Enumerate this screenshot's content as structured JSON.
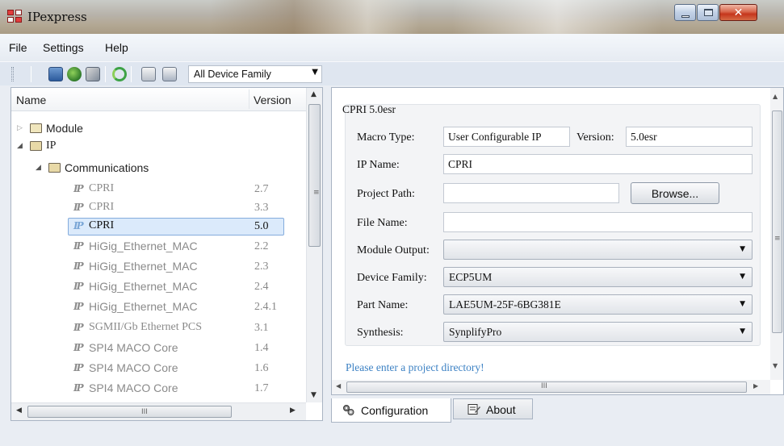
{
  "window": {
    "title": "IPexpress"
  },
  "menu": [
    "File",
    "Settings",
    "Help"
  ],
  "toolbar": {
    "family_select": "All Device Family"
  },
  "tree": {
    "header": {
      "name": "Name",
      "version": "Version"
    },
    "module_label": "Module",
    "ip_label": "IP",
    "communications_label": "Communications",
    "items": [
      {
        "name": "CPRI",
        "version": "2.7"
      },
      {
        "name": "CPRI",
        "version": "3.3"
      },
      {
        "name": "CPRI",
        "version": "5.0"
      },
      {
        "name": "HiGig_Ethernet_MAC",
        "version": "2.2"
      },
      {
        "name": "HiGig_Ethernet_MAC",
        "version": "2.3"
      },
      {
        "name": "HiGig_Ethernet_MAC",
        "version": "2.4"
      },
      {
        "name": "HiGig_Ethernet_MAC",
        "version": "2.4.1"
      },
      {
        "name": "SGMII/Gb Ethernet PCS",
        "version": "3.1"
      },
      {
        "name": "SPI4 MACO Core",
        "version": "1.4"
      },
      {
        "name": "SPI4 MACO Core",
        "version": "1.6"
      },
      {
        "name": "SPI4 MACO Core",
        "version": "1.7"
      }
    ],
    "selected_index": 2
  },
  "config": {
    "group_title": "CPRI 5.0esr",
    "macro_type_label": "Macro Type:",
    "macro_type_value": "User Configurable IP",
    "version_label": "Version:",
    "version_value": "5.0esr",
    "ip_name_label": "IP Name:",
    "ip_name_value": "CPRI",
    "project_path_label": "Project Path:",
    "project_path_value": "",
    "browse_label": "Browse...",
    "file_name_label": "File Name:",
    "file_name_value": "",
    "module_output_label": "Module Output:",
    "module_output_value": "",
    "device_family_label": "Device Family:",
    "device_family_value": "ECP5UM",
    "part_name_label": "Part Name:",
    "part_name_value": "LAE5UM-25F-6BG381E",
    "synthesis_label": "Synthesis:",
    "synthesis_value": "SynplifyPro",
    "status_message": "Please enter a project directory!"
  },
  "tabs": {
    "configuration": "Configuration",
    "about": "About"
  }
}
